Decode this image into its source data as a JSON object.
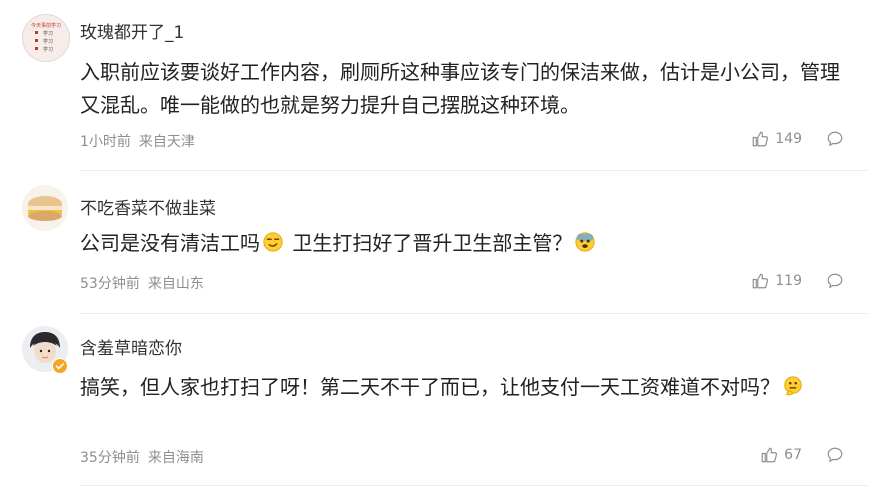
{
  "comments": [
    {
      "username": "玫瑰都开了_1",
      "avatar_text": [
        "今天事前学习",
        "学习",
        "学习",
        "学习"
      ],
      "content": "入职前应该要谈好工作内容，刷厕所这种事应该专门的保洁来做，估计是小公司，管理又混乱。唯一能做的也就是努力提升自己摆脱这种环境。",
      "time": "1小时前",
      "location": "来自天津",
      "likes": "149"
    },
    {
      "username": "不吃香菜不做韭菜",
      "content_part1": "公司是没有清洁工吗",
      "content_part2": " 卫生打扫好了晋升卫生部主管？",
      "time": "53分钟前",
      "location": "来自山东",
      "likes": "119"
    },
    {
      "username": "含羞草暗恋你",
      "content_part1": "搞笑，但人家也打扫了呀！第二天不干了而已，让他支付一天工资难道不对吗？",
      "time": "35分钟前",
      "location": "来自海南",
      "likes": "67"
    }
  ],
  "icons": {
    "like": "thumbs-up-icon",
    "reply": "comment-bubble-icon",
    "emoji_smirk": "smirk-emoji-icon",
    "emoji_scared": "scared-emoji-icon",
    "emoji_thinking": "thinking-emoji-icon",
    "verified": "verified-badge-icon"
  }
}
